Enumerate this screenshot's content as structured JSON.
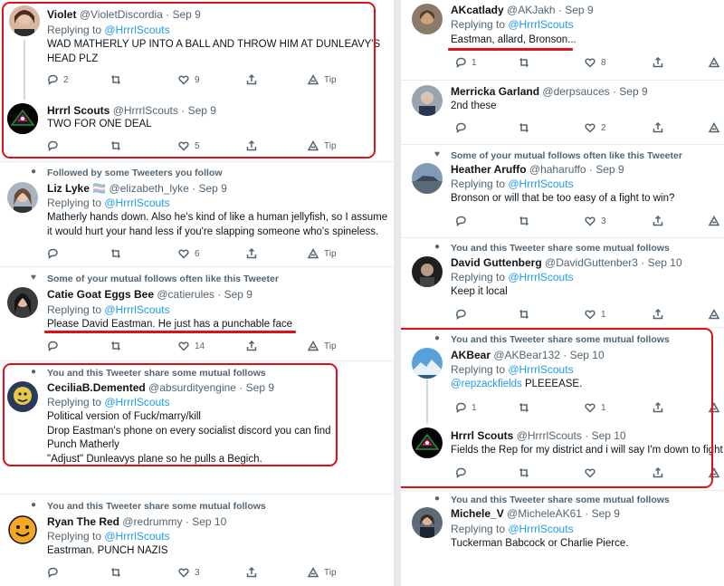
{
  "colors": {
    "accent": "#1d9bf0",
    "highlight": "#e0101a",
    "muted": "#536471"
  },
  "icons": {
    "reply": "reply-icon",
    "retweet": "retweet-icon",
    "like": "heart-icon",
    "share": "share-icon",
    "tip": "tip-icon"
  },
  "left": [
    {
      "name": "Violet",
      "handle": "@VioletDiscordia",
      "date": "· Sep 9",
      "replying_prefix": "Replying to ",
      "replying_to": "@HrrrlScouts",
      "text": "WAD MATHERLY UP INTO A BALL AND THROW HIM AT DUNLEAVY'S HEAD PLZ",
      "replies": "2",
      "retweets": "",
      "likes": "9",
      "tip": "Tip"
    },
    {
      "name": "Hrrrl Scouts",
      "handle": "@HrrrlScouts",
      "date": "· Sep 9",
      "text": "TWO FOR ONE DEAL",
      "replies": "",
      "retweets": "",
      "likes": "5",
      "tip": "Tip"
    },
    {
      "social": "Followed by some Tweeters you follow",
      "name": "Liz Lyke",
      "flag": "🏳️‍⚧️",
      "handle": "@elizabeth_lyke",
      "date": "· Sep 9",
      "replying_prefix": "Replying to ",
      "replying_to": "@HrrrlScouts",
      "text": "Matherly hands down. Also he's kind of like a human jellyfish, so I assume it would hurt your hand less if you're slapping someone who's spineless.",
      "replies": "",
      "retweets": "",
      "likes": "6",
      "tip": "Tip"
    },
    {
      "social": "Some of your mutual follows often like this Tweeter",
      "name": "Catie Goat Eggs Bee",
      "handle": "@catierules",
      "date": "· Sep 9",
      "replying_prefix": "Replying to ",
      "replying_to": "@HrrrlScouts",
      "text": "Please David Eastman. He just has a punchable face",
      "replies": "",
      "retweets": "",
      "likes": "14",
      "tip": "Tip"
    },
    {
      "social": "You and this Tweeter share some mutual follows",
      "name": "CeciliaB.Demented",
      "handle": "@absurdityengine",
      "date": "· Sep 9",
      "replying_prefix": "Replying to ",
      "replying_to": "@HrrrlScouts",
      "text": "Political version of Fuck/marry/kill\nDrop Eastman's phone on every socialist discord you can find\nPunch Matherly\n\"Adjust\" Dunleavys plane so he pulls a Begich."
    },
    {
      "social": "You and this Tweeter share some mutual follows",
      "name": "Ryan The Red",
      "handle": "@redrummy",
      "date": "· Sep 10",
      "replying_prefix": "Replying to ",
      "replying_to": "@HrrrlScouts",
      "text": "Eastrman. PUNCH NAZIS",
      "replies": "",
      "retweets": "",
      "likes": "3",
      "tip": "Tip"
    }
  ],
  "right": [
    {
      "name": "AKcatlady",
      "handle": "@AKJakh",
      "date": "· Sep 9",
      "replying_prefix": "Replying to ",
      "replying_to": "@HrrrlScouts",
      "text": "Eastman, allard, Bronson...",
      "replies": "1",
      "retweets": "",
      "likes": "8"
    },
    {
      "name": "Merricka Garland",
      "handle": "@derpsauces",
      "date": "· Sep 9",
      "text": "2nd these",
      "replies": "",
      "retweets": "",
      "likes": "2"
    },
    {
      "social": "Some of your mutual follows often like this Tweeter",
      "name": "Heather Aruffo",
      "handle": "@haharuffo",
      "date": "· Sep 9",
      "replying_prefix": "Replying to ",
      "replying_to": "@HrrrlScouts",
      "text": "Bronson or will that be too easy of a fight to win?",
      "replies": "",
      "retweets": "",
      "likes": "3"
    },
    {
      "social": "You and this Tweeter share some mutual follows",
      "name": "David Guttenberg",
      "handle": "@DavidGuttenber3",
      "date": "· Sep 10",
      "replying_prefix": "Replying to ",
      "replying_to": "@HrrrlScouts",
      "text": "Keep it local",
      "replies": "",
      "retweets": "",
      "likes": "1"
    },
    {
      "social": "You and this Tweeter share some mutual follows",
      "name": "AKBear",
      "handle": "@AKBear132",
      "date": "· Sep 10",
      "replying_prefix": "Replying to ",
      "replying_to": "@HrrrlScouts",
      "mention": "@repzackfields",
      "text": " PLEEEASE.",
      "replies": "1",
      "retweets": "",
      "likes": "1"
    },
    {
      "name": "Hrrrl Scouts",
      "handle": "@HrrrlScouts",
      "date": "· Sep 10",
      "text": "Fields the Rep for my district and i will say I'm down to fight"
    },
    {
      "social": "You and this Tweeter share some mutual follows",
      "name": "Michele_V",
      "handle": "@MicheleAK61",
      "date": "· Sep 9",
      "replying_prefix": "Replying to ",
      "replying_to": "@HrrrlScouts",
      "text": "Tuckerman Babcock or Charlie Pierce."
    }
  ]
}
